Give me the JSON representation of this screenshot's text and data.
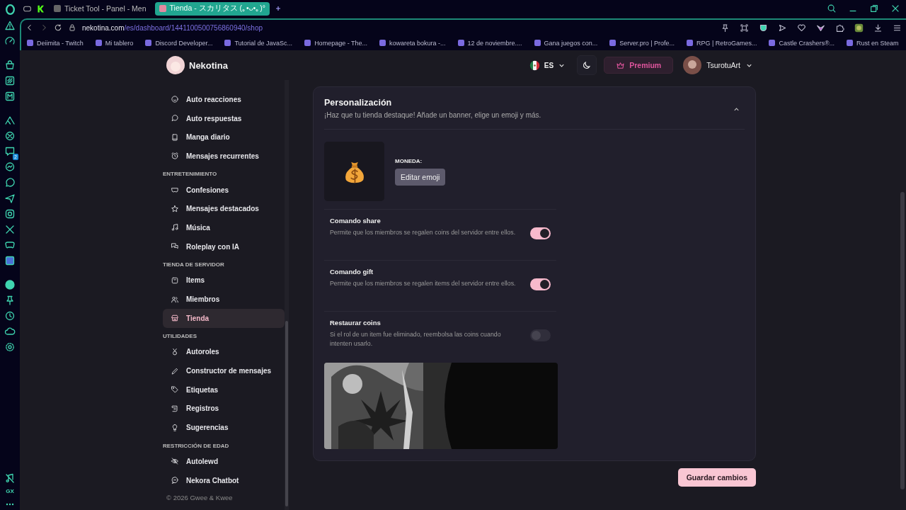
{
  "browser": {
    "tabs": [
      {
        "title": "Ticket Tool - Panel - Men",
        "selected": false
      },
      {
        "title": "Tienda - スカリタス (｡•ᴗ•｡)°",
        "selected": true
      }
    ],
    "url": {
      "host": "nekotina.com",
      "path": "/es/dashboard/1441100500756860940/shop"
    },
    "bookmarks": [
      {
        "label": "Deiimita - Twitch"
      },
      {
        "label": "Mi tablero"
      },
      {
        "label": "Discord Developer..."
      },
      {
        "label": "Tutorial de JavaSc..."
      },
      {
        "label": "Homepage - The..."
      },
      {
        "label": "kowareta bokura -..."
      },
      {
        "label": "12 de noviembre...."
      },
      {
        "label": "Gana juegos con..."
      },
      {
        "label": "Server.pro | Profe..."
      },
      {
        "label": "RPG | RetroGames..."
      },
      {
        "label": "Castle Crashers®..."
      },
      {
        "label": "Rust en Steam"
      }
    ],
    "side_badge": "2",
    "gx_label": "GX"
  },
  "header": {
    "brand": "Nekotina",
    "language": "ES",
    "premium": "Premium",
    "user": "TsurotuArt"
  },
  "sidebar": {
    "groups": [
      {
        "items": [
          {
            "label": "Auto reacciones",
            "selected": false
          },
          {
            "label": "Auto respuestas",
            "selected": false
          },
          {
            "label": "Manga diario",
            "selected": false
          },
          {
            "label": "Mensajes recurrentes",
            "selected": false
          }
        ]
      },
      {
        "title": "ENTRETENIMIENTO",
        "items": [
          {
            "label": "Confesiones",
            "selected": false
          },
          {
            "label": "Mensajes destacados",
            "selected": false
          },
          {
            "label": "Música",
            "selected": false
          },
          {
            "label": "Roleplay con IA",
            "selected": false
          }
        ]
      },
      {
        "title": "TIENDA DE SERVIDOR",
        "items": [
          {
            "label": "Items",
            "selected": false
          },
          {
            "label": "Miembros",
            "selected": false
          },
          {
            "label": "Tienda",
            "selected": true
          }
        ]
      },
      {
        "title": "UTILIDADES",
        "items": [
          {
            "label": "Autoroles",
            "selected": false
          },
          {
            "label": "Constructor de mensajes",
            "selected": false
          },
          {
            "label": "Etiquetas",
            "selected": false
          },
          {
            "label": "Registros",
            "selected": false
          },
          {
            "label": "Sugerencias",
            "selected": false
          }
        ]
      },
      {
        "title": "RESTRICCIÓN DE EDAD",
        "items": [
          {
            "label": "Autolewd",
            "selected": false
          },
          {
            "label": "Nekora Chatbot",
            "selected": false
          }
        ]
      }
    ],
    "footer": "© 2026 Gwee & Kwee"
  },
  "card": {
    "title": "Personalización",
    "subtitle": "¡Haz que tu tienda destaque! Añade un banner, elige un emoji y más.",
    "expanded": true,
    "currency": {
      "label": "MONEDA:",
      "button": "Editar emoji"
    },
    "settings": [
      {
        "title": "Comando share",
        "description": "Permite que los miembros se regalen coins del servidor entre ellos.",
        "on": true
      },
      {
        "title": "Comando gift",
        "description": "Permite que los miembros se regalen items del servidor entre ellos.",
        "on": true
      },
      {
        "title": "Restaurar coins",
        "description": "Si el rol de un item fue eliminado, reembolsa las coins cuando intenten usarlo.",
        "on": false
      }
    ]
  },
  "save_button": "Guardar cambios"
}
